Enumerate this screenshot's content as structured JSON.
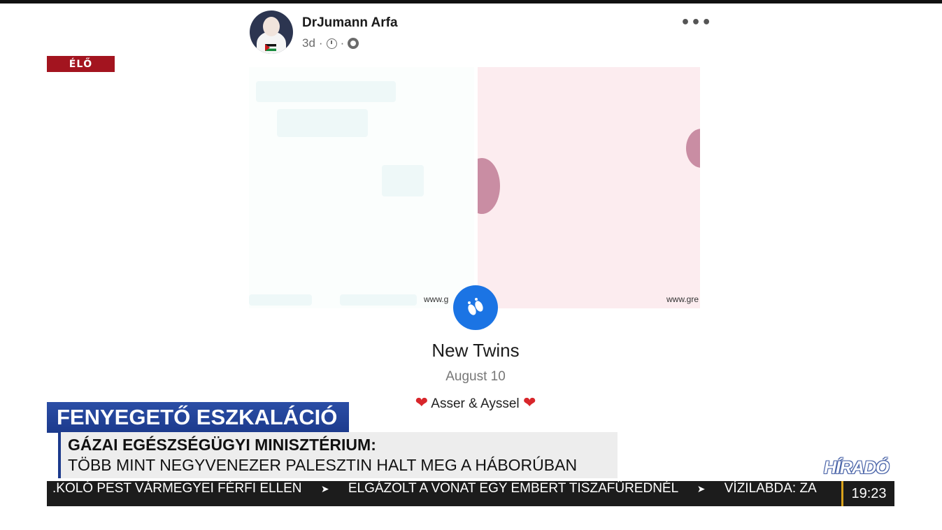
{
  "live_badge": "ÉLŐ",
  "post": {
    "author": "DrJumann Arfa",
    "time": "3d",
    "separator": "·",
    "more_icon": "more-dots-icon",
    "watermark_left": "www.g",
    "watermark_right": "www.gre",
    "event_icon": "baby-feet-icon",
    "event_title": "New Twins",
    "event_date": "August 10",
    "names": "Asser & Ayssel",
    "heart": "❤"
  },
  "chyron": {
    "headline": "FENYEGETŐ ESZKALÁCIÓ",
    "sub_title": "GÁZAI EGÉSZSÉGÜGYI MINISZTÉRIUM:",
    "sub_text": "TÖBB MINT NEGYVENEZER PALESZTIN HALT MEG A HÁBORÚBAN"
  },
  "brand": "HÍRADÓ",
  "ticker": {
    "items": [
      ".KOLÓ PEST VÁRMEGYEI FÉRFI ELLEN",
      "ELGÁZOLT A VONAT EGY EMBERT TISZAFÜREDNÉL",
      "VÍZILABDA: ZA"
    ],
    "separator": "➤",
    "clock": "19:23"
  },
  "colors": {
    "live_red": "#a3141f",
    "headline_blue": "#1c3a8c",
    "facebook_blue": "#1b74e4",
    "ticker_bg": "#1c1c1c"
  }
}
